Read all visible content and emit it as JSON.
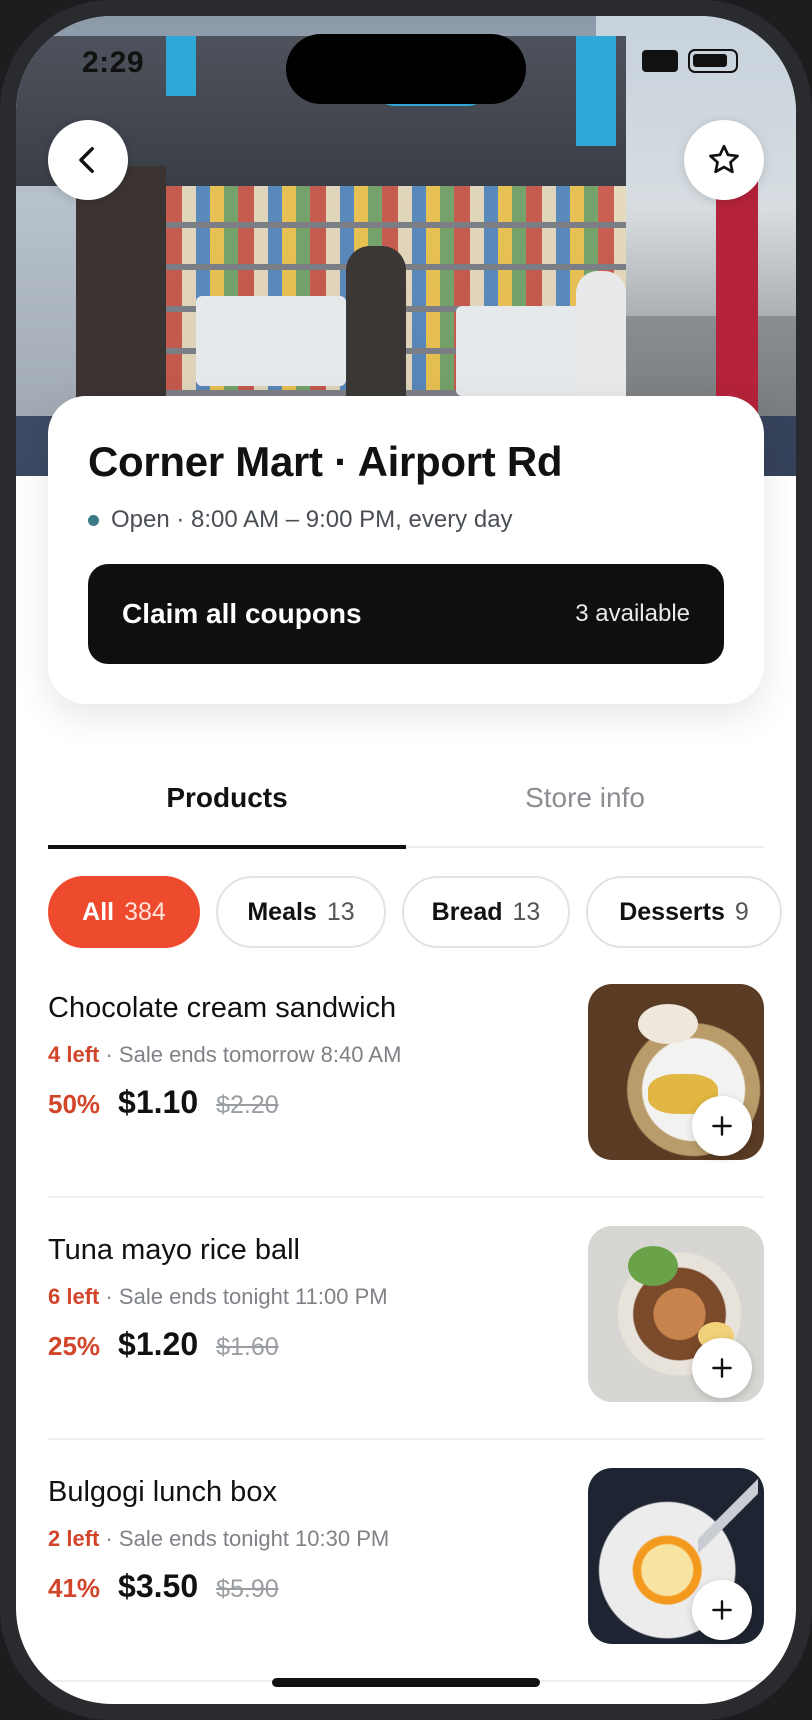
{
  "status_bar": {
    "time": "2:29"
  },
  "store": {
    "name": "Corner Mart · Airport Rd",
    "hours": "Open · 8:00 AM – 9:00 PM, every day",
    "claim_label": "Claim all coupons",
    "claim_count": "3 available"
  },
  "tabs": [
    {
      "label": "Products",
      "active": true
    },
    {
      "label": "Store info",
      "active": false
    }
  ],
  "categories": [
    {
      "label": "All",
      "count": "384",
      "active": true
    },
    {
      "label": "Meals",
      "count": "13",
      "active": false
    },
    {
      "label": "Bread",
      "count": "13",
      "active": false
    },
    {
      "label": "Desserts",
      "count": "9",
      "active": false
    }
  ],
  "products": [
    {
      "name": "Chocolate cream sandwich",
      "left": "4 left",
      "sale": "· Sale ends tomorrow 8:40 AM",
      "discount": "50%",
      "price": "$1.10",
      "original": "$2.20"
    },
    {
      "name": "Tuna mayo rice ball",
      "left": "6 left",
      "sale": "· Sale ends tonight 11:00 PM",
      "discount": "25%",
      "price": "$1.20",
      "original": "$1.60"
    },
    {
      "name": "Bulgogi lunch box",
      "left": "2 left",
      "sale": "· Sale ends tonight 10:30 PM",
      "discount": "41%",
      "price": "$3.50",
      "original": "$5.90"
    }
  ],
  "icons": {
    "back": "chevron-left-icon",
    "favorite": "star-icon",
    "add": "plus-icon"
  },
  "colors": {
    "accent": "#ee4a2e",
    "discount_text": "#d2452a",
    "button_dark": "#0f0f10",
    "open_dot": "#3a7b86"
  }
}
